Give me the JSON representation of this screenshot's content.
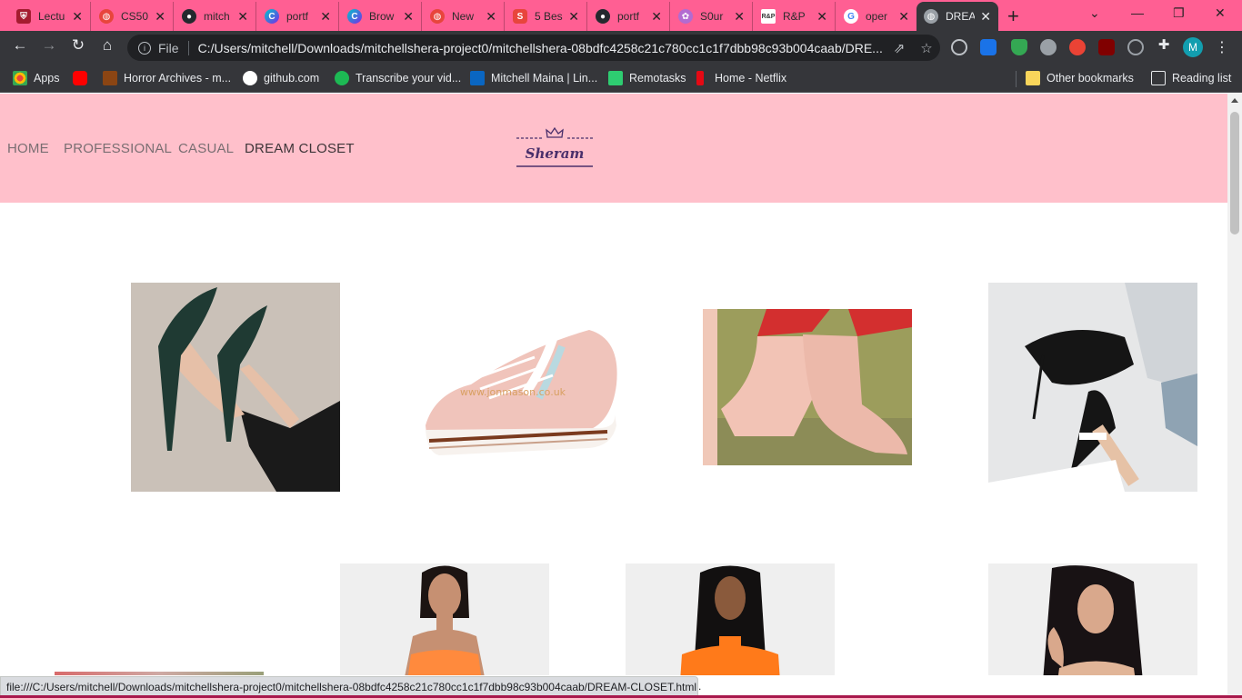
{
  "browser": {
    "tabs": [
      {
        "title": "Lectu",
        "icon": "harvard-shield-icon",
        "color": "#a51c30"
      },
      {
        "title": "CS50",
        "icon": "globe-icon",
        "color": "#5f6368"
      },
      {
        "title": "mitch",
        "icon": "github-icon",
        "color": "#24292e"
      },
      {
        "title": "portf",
        "icon": "canva-icon",
        "color": "#00c4cc"
      },
      {
        "title": "Brow",
        "icon": "canva-icon",
        "color": "#00c4cc"
      },
      {
        "title": "New",
        "icon": "globe-icon",
        "color": "#5f6368"
      },
      {
        "title": "5 Bes",
        "icon": "s-logo-icon",
        "color": "#e8453c"
      },
      {
        "title": "portf",
        "icon": "github-icon",
        "color": "#24292e"
      },
      {
        "title": "S0ur",
        "icon": "flower-icon",
        "color": "#9b59b6"
      },
      {
        "title": "R&P",
        "icon": "rp-icon",
        "color": "#ffffff"
      },
      {
        "title": "oper",
        "icon": "google-icon",
        "color": "#4285f4"
      },
      {
        "title": "DREA",
        "icon": "globe-icon",
        "color": "#9aa0a6"
      }
    ],
    "new_tab": "+",
    "minimize": "—",
    "restore": "❐",
    "close": "✕",
    "url_scheme_label": "File",
    "url": "C:/Users/mitchell/Downloads/mitchellshera-project0/mitchellshera-08bdfc4258c21c780cc1c1f7dbb98c93b004caab/DRE...",
    "profile_initial": "M",
    "bookmarks": [
      {
        "label": "Apps",
        "icon": "apps-grid-icon",
        "color": "#e8453c"
      },
      {
        "label": "",
        "icon": "youtube-icon",
        "color": "#ff0000"
      },
      {
        "label": "Horror Archives - m...",
        "icon": "horror-archives-icon",
        "color": "#8b4513"
      },
      {
        "label": "github.com",
        "icon": "github-icon",
        "color": "#ffffff"
      },
      {
        "label": "Transcribe your vid...",
        "icon": "fi-icon",
        "color": "#1db954"
      },
      {
        "label": "Mitchell Maina | Lin...",
        "icon": "linkedin-icon",
        "color": "#0a66c2"
      },
      {
        "label": "Remotasks",
        "icon": "remotasks-icon",
        "color": "#2ecc71"
      },
      {
        "label": "Home - Netflix",
        "icon": "netflix-icon",
        "color": "#e50914"
      }
    ],
    "other_bookmarks": "Other bookmarks",
    "reading_list": "Reading list",
    "status_url": "file:///C:/Users/mitchell/Downloads/mitchellshera-project0/mitchellshera-08bdfc4258c21c780cc1c1f7dbb98c93b004caab/DREAM-CLOSET.html",
    "status_tail": "."
  },
  "site": {
    "nav": [
      "HOME",
      "PROFESSIONAL",
      "CASUAL",
      "DREAM CLOSET"
    ],
    "logo_text": "Sheram",
    "colors": {
      "navbar": "#ffc0cb",
      "logo": "#4a2f6b"
    },
    "products": [
      {
        "name": "dark-green-stiletto-heels-image"
      },
      {
        "name": "pink-platform-sneaker-image",
        "watermark": "www.jonmason.co.uk"
      },
      {
        "name": "pink-suede-ankle-boots-image"
      },
      {
        "name": "black-mule-heels-image"
      },
      {
        "name": "orange-satin-dress-image"
      },
      {
        "name": "orange-mock-neck-dress-image"
      },
      {
        "name": "nude-dress-model-image"
      },
      {
        "name": "partial-product-image"
      }
    ]
  }
}
